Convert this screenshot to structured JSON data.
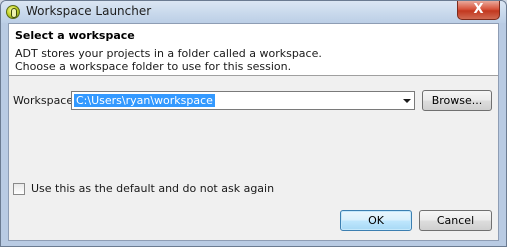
{
  "window": {
    "title": "Workspace Launcher",
    "close_label": "X"
  },
  "header": {
    "title": "Select a workspace",
    "description_lines": [
      "ADT stores your projects in a folder called a workspace.",
      "Choose a workspace folder to use for this session."
    ]
  },
  "workspace": {
    "label": "Workspace:",
    "value": "C:\\Users\\ryan\\workspace",
    "browse_label": "Browse..."
  },
  "default_option": {
    "label": "Use this as the default and do not ask again",
    "checked": false
  },
  "buttons": {
    "ok": "OK",
    "cancel": "Cancel"
  },
  "icons": {
    "app": "adt-launcher-icon",
    "combo": "chevron-down-icon",
    "close": "close-icon"
  },
  "colors": {
    "selection": "#3399ff",
    "close_button": "#c2381f",
    "default_button_border": "#3c7fb1"
  }
}
